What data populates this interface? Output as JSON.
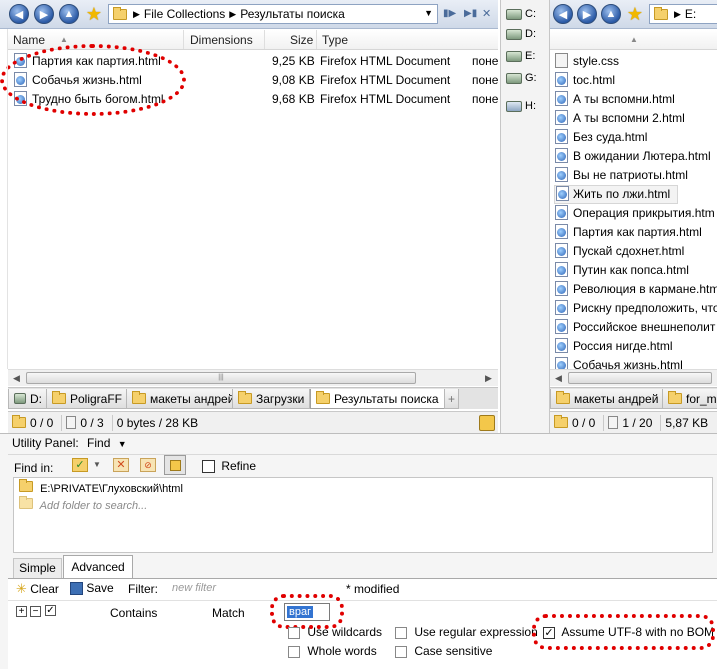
{
  "left_pane": {
    "path": [
      "File Collections",
      "Результаты поиска"
    ],
    "columns": [
      "Name",
      "Dimensions",
      "Size",
      "Type"
    ],
    "files": [
      {
        "name": "Партия как партия.html",
        "size": "9,25 KB",
        "type": "Firefox HTML Document",
        "extra": "поне"
      },
      {
        "name": "Собачья жизнь.html",
        "size": "9,08 KB",
        "type": "Firefox HTML Document",
        "extra": "поне"
      },
      {
        "name": "Трудно быть богом.html",
        "size": "9,68 KB",
        "type": "Firefox HTML Document",
        "extra": "поне"
      }
    ],
    "tabs": [
      "D:",
      "PoligraFF",
      "макеты андрей",
      "Загрузки",
      "Результаты поиска",
      "+"
    ],
    "status": {
      "selected": "0 / 0",
      "files": "0 / 3",
      "bytes": "0 bytes / 28 KB"
    }
  },
  "drives": [
    "C:",
    "D:",
    "E:",
    "G:",
    "H:"
  ],
  "right_pane": {
    "path": "E:",
    "files": [
      "style.css",
      "toc.html",
      "А ты вспомни.html",
      "А ты вспомни 2.html",
      "Без суда.html",
      "В ожидании Лютера.html",
      "Вы не патриоты.html",
      "Жить по лжи.html",
      "Операция прикрытия.htm",
      "Партия как партия.html",
      "Пускай сдохнет.html",
      "Путин как попса.html",
      "Революция в кармане.htm",
      "Рискну предположить, что",
      "Российское внешнеполит",
      "Россия нигде.html",
      "Собачья жизнь.html"
    ],
    "selected_index": 7,
    "tabs": [
      "макеты андрей",
      "for_me"
    ],
    "status": {
      "selected": "0 / 0",
      "files": "1 / 20",
      "bytes": "5,87 KB"
    }
  },
  "utility": {
    "panel_label": "Utility Panel:",
    "panel_value": "Find",
    "find_in_label": "Find in:",
    "refine_label": "Refine",
    "folder_path": "E:\\PRIVATE\\Глуховский\\html",
    "add_folder_placeholder": "Add folder to search...",
    "tabs": [
      "Simple",
      "Advanced"
    ],
    "clear_label": "Clear",
    "save_label": "Save",
    "filter_label": "Filter:",
    "filter_placeholder": "new filter",
    "modified_label": "* modified",
    "rule": {
      "field": "Contains",
      "op": "Match",
      "value": "враг"
    },
    "options": {
      "use_wildcards": "Use wildcards",
      "whole_words": "Whole words",
      "use_regex": "Use regular expression",
      "case_sensitive": "Case sensitive",
      "utf8": "Assume UTF-8 with no BOM"
    }
  }
}
